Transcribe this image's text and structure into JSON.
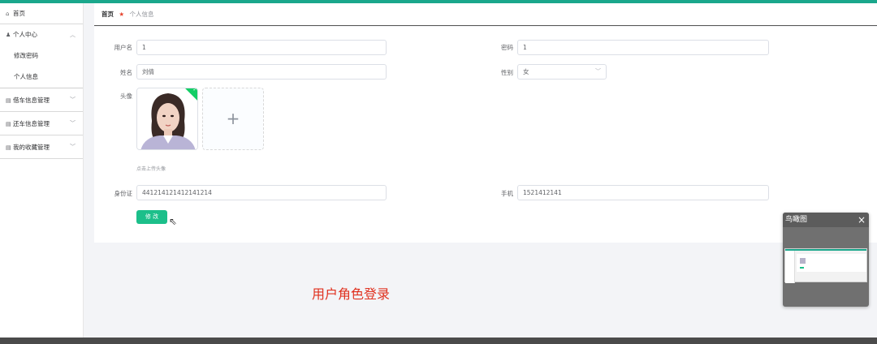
{
  "sidebar": {
    "items": [
      {
        "icon": "home-icon",
        "label": "首页"
      },
      {
        "icon": "user-icon",
        "label": "个人中心",
        "expanded": true,
        "children": [
          "修改密码",
          "个人信息"
        ]
      },
      {
        "icon": "list-icon",
        "label": "借车信息管理"
      },
      {
        "icon": "list-icon",
        "label": "还车信息管理"
      },
      {
        "icon": "list-icon",
        "label": "我的收藏管理"
      }
    ]
  },
  "breadcrumb": {
    "home": "首页",
    "current": "个人信息"
  },
  "form": {
    "username": {
      "label": "用户名",
      "value": "1"
    },
    "password": {
      "label": "密码",
      "value": "1"
    },
    "name": {
      "label": "姓名",
      "value": "刘倩"
    },
    "gender": {
      "label": "性别",
      "value": "女"
    },
    "avatar": {
      "label": "头像",
      "hint": "点击上传头像"
    },
    "id_card": {
      "label": "身份证",
      "value": "441214121412141214"
    },
    "phone": {
      "label": "手机",
      "value": "1521412141"
    },
    "submit_label": "修 改"
  },
  "caption": "用户角色登录",
  "minimap": {
    "title": "鸟瞰图"
  },
  "colors": {
    "accent": "#1aa78c",
    "button": "#1cbf8a",
    "caption": "#e0301e"
  }
}
